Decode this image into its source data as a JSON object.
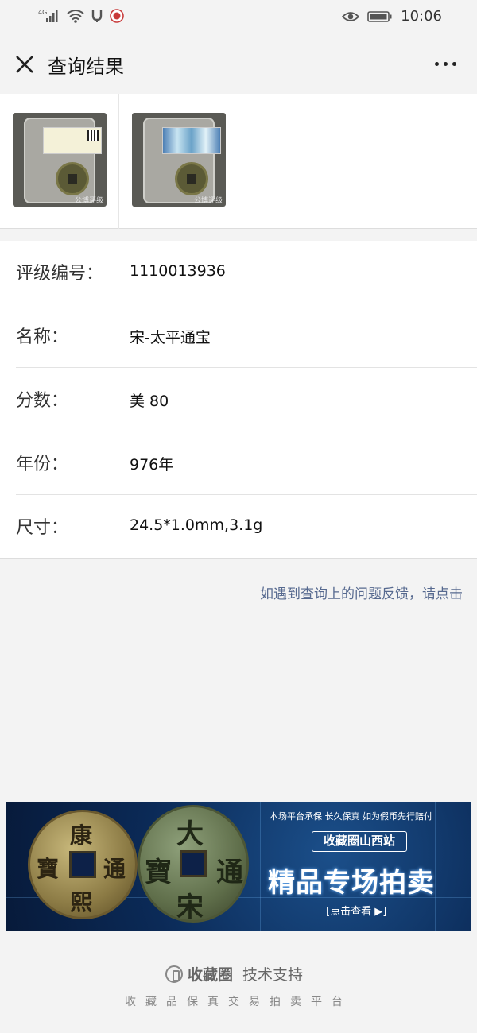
{
  "status_bar": {
    "network": "4G",
    "time": "10:06"
  },
  "nav": {
    "title": "查询结果",
    "close_icon": "close-icon",
    "more_icon": "more-dots-icon"
  },
  "thumbnails": [
    {
      "watermark": "公博评级"
    },
    {
      "watermark": "公博评级"
    }
  ],
  "details": [
    {
      "label": "评级编号：",
      "value": "1110013936"
    },
    {
      "label": "名称：",
      "value": "宋-太平通宝"
    },
    {
      "label": "分数：",
      "value": "美 80"
    },
    {
      "label": "年份：",
      "value": "976年"
    },
    {
      "label": "尺寸：",
      "value": "24.5*1.0mm,3.1g"
    }
  ],
  "feedback_link": "如遇到查询上的问题反馈，请点击",
  "banner": {
    "top_text": "本场平台承保 长久保真 如为假币先行赔付",
    "tag": "收藏圈山西站",
    "title": "精品专场拍卖",
    "cta": "[点击查看 ▶]"
  },
  "footer": {
    "brand": "收藏圈",
    "support": "技术支持",
    "slogan": "收藏品保真交易拍卖平台"
  },
  "colors": {
    "link": "#56698f",
    "background": "#f3f3f3",
    "banner_bg": "#0b2a57"
  }
}
